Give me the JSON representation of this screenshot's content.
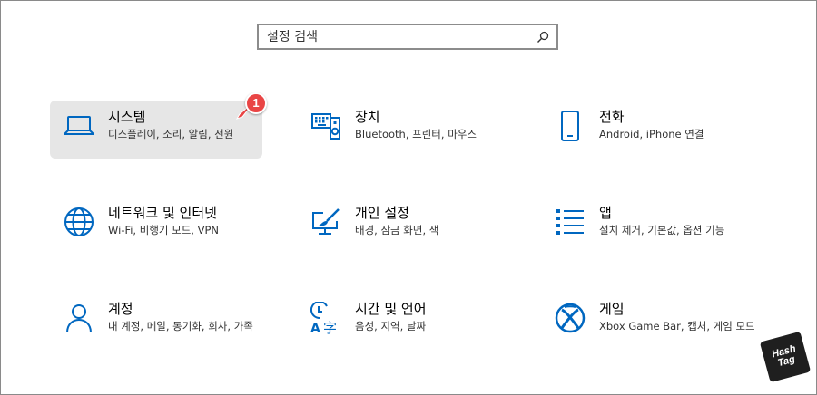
{
  "search": {
    "placeholder": "설정 검색",
    "icon": "search-icon"
  },
  "accent": "#0067c0",
  "tiles": [
    {
      "title": "시스템",
      "desc": "디스플레이, 소리, 알림, 전원",
      "icon": "laptop-icon",
      "selected": true
    },
    {
      "title": "장치",
      "desc": "Bluetooth, 프린터, 마우스",
      "icon": "devices-icon"
    },
    {
      "title": "전화",
      "desc": "Android, iPhone 연결",
      "icon": "phone-icon"
    },
    {
      "title": "네트워크 및 인터넷",
      "desc": "Wi-Fi, 비행기 모드, VPN",
      "icon": "globe-icon"
    },
    {
      "title": "개인 설정",
      "desc": "배경, 잠금 화면, 색",
      "icon": "paint-icon"
    },
    {
      "title": "앱",
      "desc": "설치 제거, 기본값, 옵션 기능",
      "icon": "apps-list-icon"
    },
    {
      "title": "계정",
      "desc": "내 계정, 메일, 동기화, 회사, 가족",
      "icon": "person-icon"
    },
    {
      "title": "시간 및 언어",
      "desc": "음성, 지역, 날짜",
      "icon": "time-language-icon"
    },
    {
      "title": "게임",
      "desc": "Xbox Game Bar, 캡처, 게임 모드",
      "icon": "xbox-icon"
    }
  ],
  "badge": {
    "number": "1",
    "color": "#e94545"
  },
  "logo": {
    "line1": "Hash",
    "line2": "Tag"
  }
}
